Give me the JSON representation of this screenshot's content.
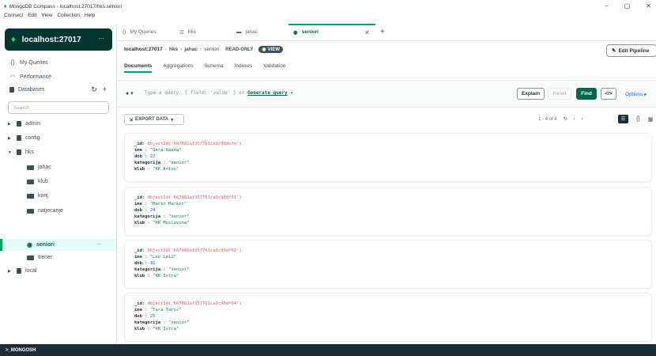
{
  "window": {
    "title": "MongoDB Compass - localhost:27017/hks.seniori",
    "controls": [
      "–",
      "▢",
      "✕"
    ],
    "menu": [
      "Connect",
      "Edit",
      "View",
      "Collection",
      "Help"
    ]
  },
  "connection": {
    "name": "localhost:27017",
    "more": "···"
  },
  "sidebar": {
    "my_queries": "My Queries",
    "performance": "Performance",
    "databases": "Databases",
    "search_placeholder": "Search",
    "tree": {
      "admin": "admin",
      "config": "config",
      "hks": "hks",
      "collections": [
        "jahac",
        "klub",
        "konj",
        "natjecanje",
        "seniori",
        "trener"
      ],
      "local": "local",
      "active_more": "···"
    }
  },
  "tabs": [
    {
      "label": "My Queries"
    },
    {
      "label": "hks"
    },
    {
      "label": "jahac"
    },
    {
      "label": "seniori"
    }
  ],
  "breadcrumb": {
    "root": "localhost:27017",
    "db": "hks",
    "source": "jahac",
    "collection": "seniori",
    "readonly": "READ-ONLY",
    "view_badge": "VIEW"
  },
  "edit_pipeline": "Edit Pipeline",
  "subtabs": [
    "Documents",
    "Aggregations",
    "Schema",
    "Indexes",
    "Validation"
  ],
  "query": {
    "placeholder": "Type a query: { field: 'value' } or",
    "generate": "Generate query",
    "explain": "Explain",
    "reset": "Reset",
    "find": "Find",
    "code": "</>",
    "options": "Options ▸"
  },
  "export_label": "EXPORT DATA",
  "pager": {
    "range": "1 - 4 of 4"
  },
  "documents": [
    {
      "id": "ObjectId('667882af357761ca9c90defe')",
      "ime": "\"Sara Gazda\"",
      "dob": "22",
      "kategorija": "\"senior\"",
      "klub": "\"KK Arion\""
    },
    {
      "id": "ObjectId('667882af357761ca9c90df01')",
      "ime": "\"Marko Markic\"",
      "dob": "24",
      "kategorija": "\"senior\"",
      "klub": "\"KK Moslavina\""
    },
    {
      "id": "ObjectId('667882af357761ca9c90df02')",
      "ime": "\"Leo Leic\"",
      "dob": "31",
      "kategorija": "\"senior\"",
      "klub": "\"KK Istra\""
    },
    {
      "id": "ObjectId('667882af357761ca9c90df04')",
      "ime": "\"Tara Taric\"",
      "dob": "25",
      "kategorija": "\"senior\"",
      "klub": "\"KK Istra\""
    }
  ],
  "fields": {
    "id": "_id",
    "ime": "ime",
    "dob": "dob",
    "kategorija": "kategorija",
    "klub": "klub"
  },
  "bottom": ">_MONGOSH",
  "colors": {
    "accent": "#00a35c",
    "dark": "#023430",
    "find": "#00684a",
    "link": "#016bf8"
  }
}
